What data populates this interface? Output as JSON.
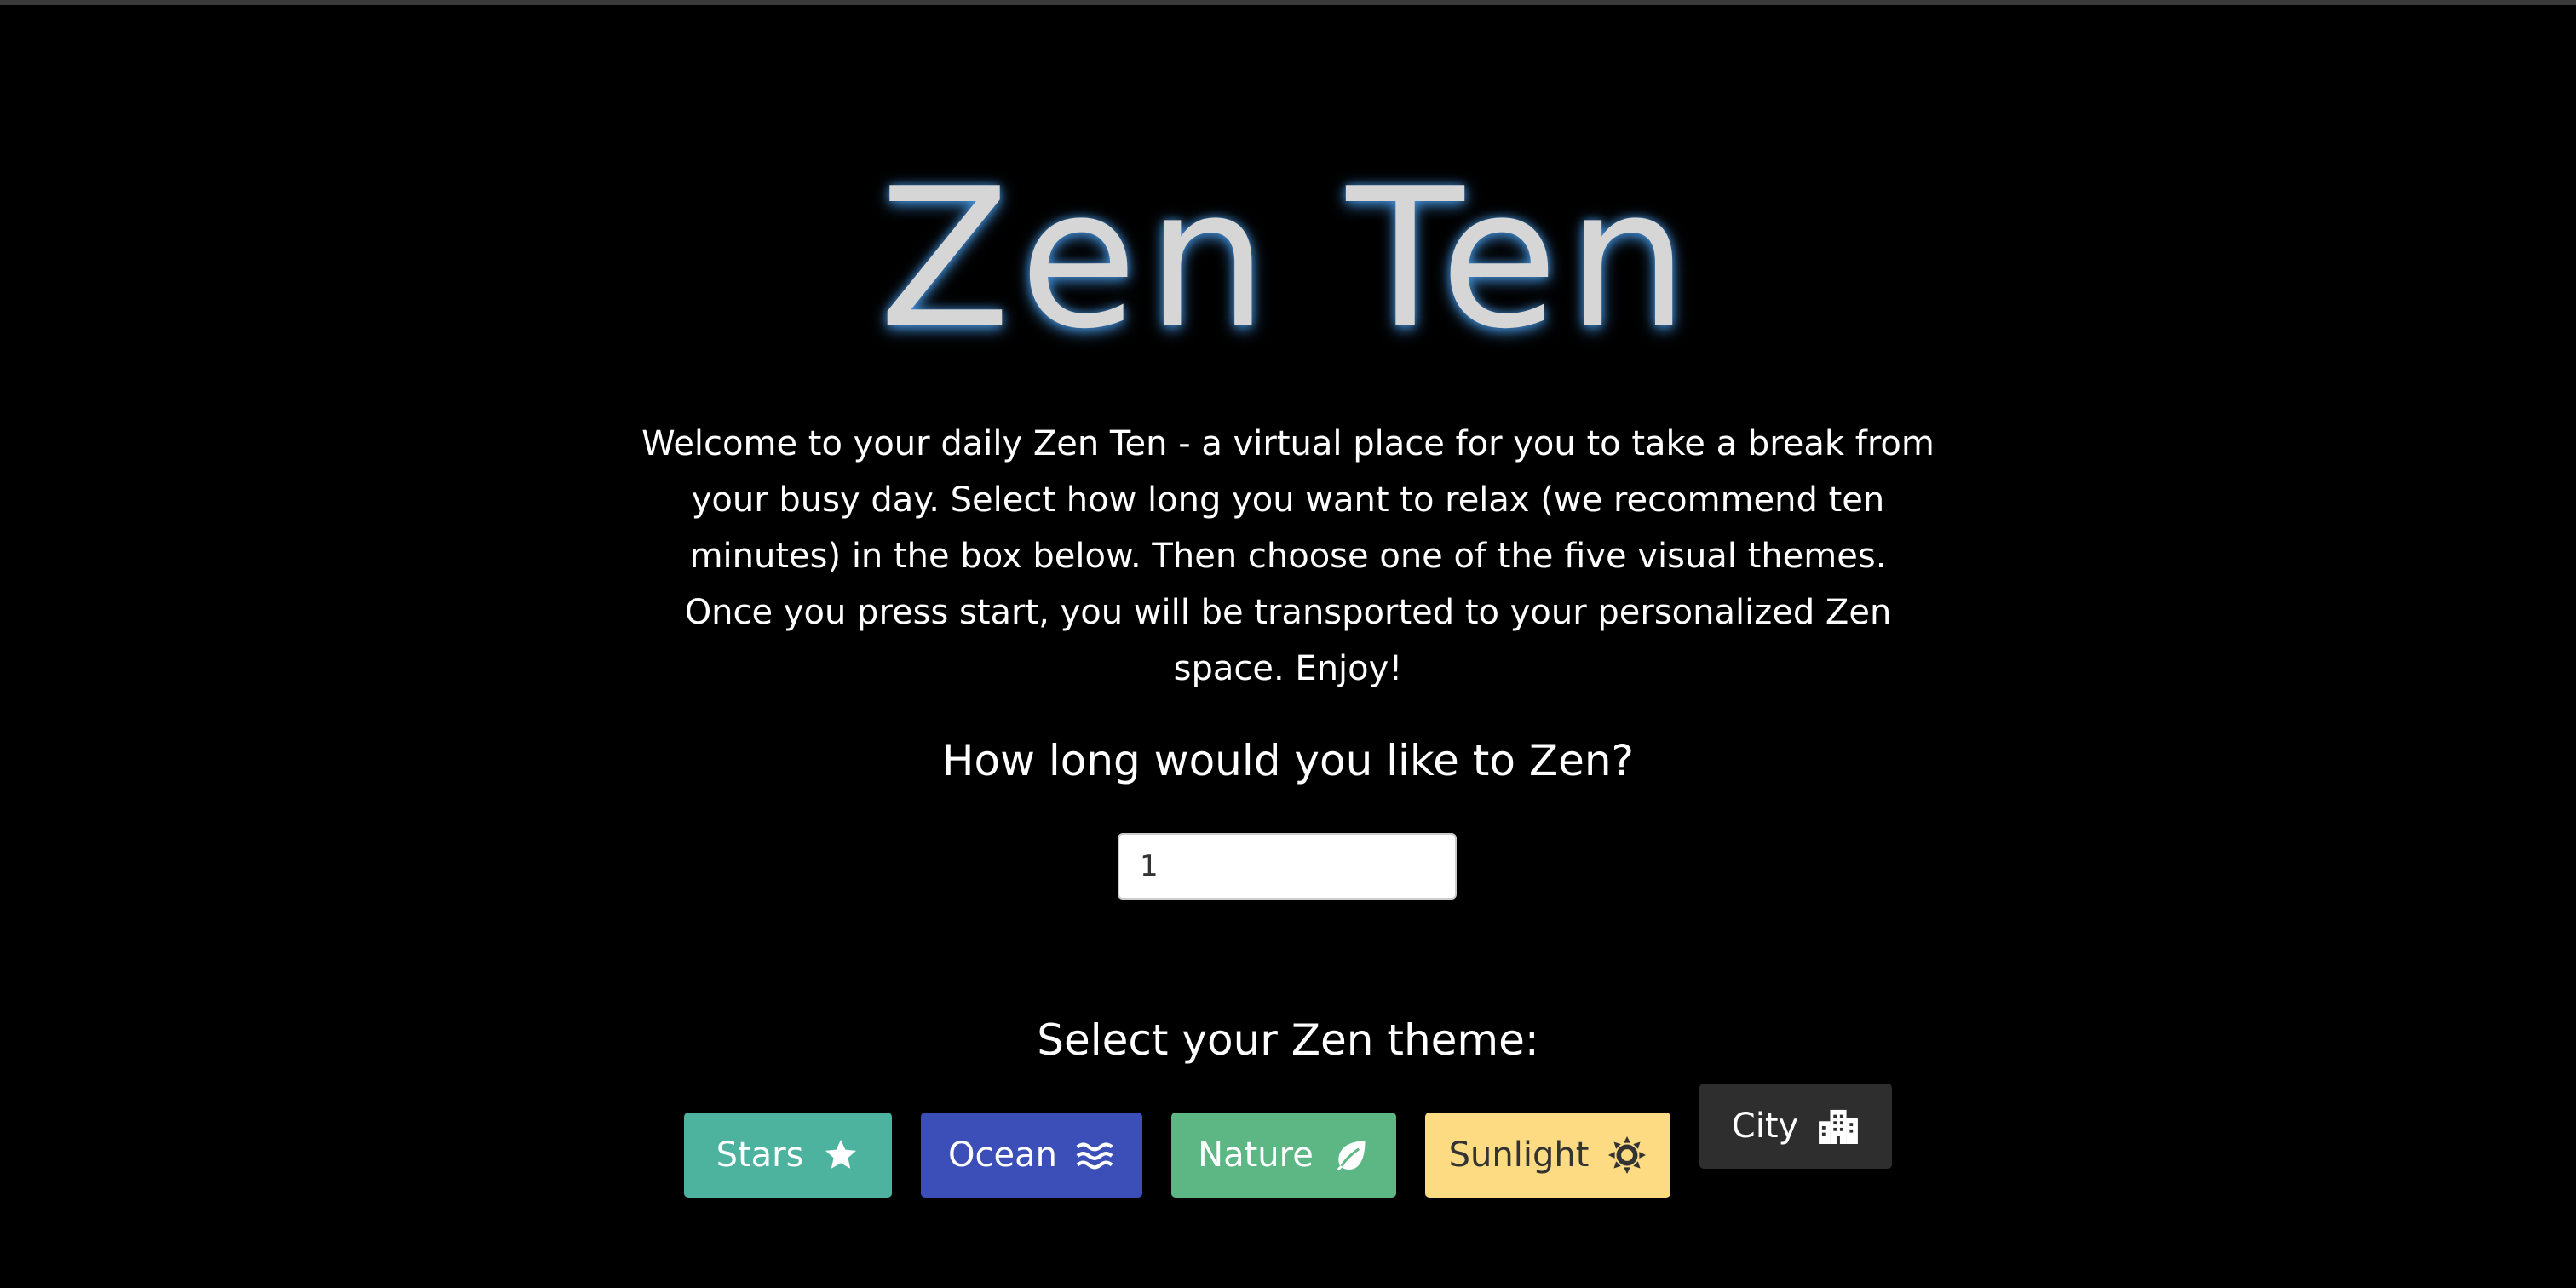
{
  "header": {
    "title": "Zen Ten"
  },
  "intro": {
    "text": "Welcome to your daily Zen Ten - a virtual place for you to take a break from your busy day. Select how long you want to relax (we recommend ten minutes) in the box below. Then choose one of the five visual themes. Once you press start, you will be transported to your personalized Zen space. Enjoy!"
  },
  "duration": {
    "question": "How long would you like to Zen?",
    "value": "1"
  },
  "themes": {
    "heading": "Select your Zen theme:",
    "buttons": [
      {
        "label": "Stars",
        "icon": "star-icon",
        "color": "#4db39e"
      },
      {
        "label": "Ocean",
        "icon": "water-icon",
        "color": "#3c4fb8"
      },
      {
        "label": "Nature",
        "icon": "leaf-icon",
        "color": "#5cb785"
      },
      {
        "label": "Sunlight",
        "icon": "sun-icon",
        "color": "#fcdb82"
      },
      {
        "label": "City",
        "icon": "city-icon",
        "color": "#2e2e2e"
      }
    ]
  }
}
